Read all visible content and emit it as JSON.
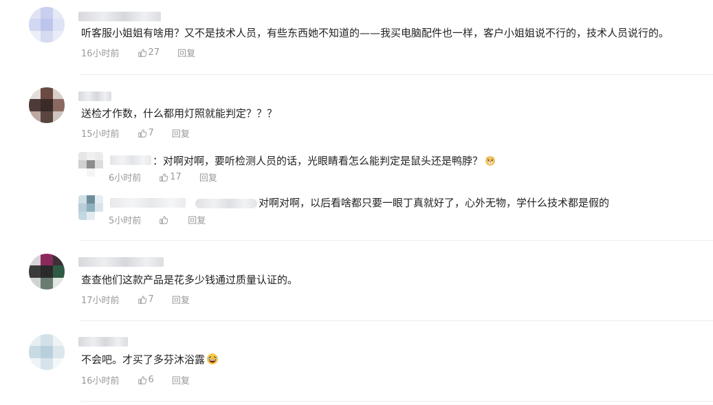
{
  "comments": [
    {
      "text": "听客服小姐姐有啥用？又不是技术人员，有些东西她不知道的——我买电脑配件也一样，客户小姐姐说不行的，技术人员说行的。",
      "time": "16小时前",
      "likes": "27",
      "reply": "回复"
    },
    {
      "text": "送检才作数，什么都用灯照就能判定？？？",
      "time": "15小时前",
      "likes": "7",
      "reply": "回复",
      "replies": [
        {
          "text": "：对啊对啊，要听检测人员的话，光眼睛看怎么能判定是鼠头还是鸭脖？",
          "emoji": "doge-emoji",
          "time": "6小时前",
          "likes": "17",
          "reply": "回复"
        },
        {
          "text": "对啊对啊，以后看啥都只要一眼丁真就好了，心外无物，学什么技术都是假的",
          "time": "5小时前",
          "likes": "",
          "reply": "回复"
        }
      ]
    },
    {
      "text": "查查他们这款产品是花多少钱通过质量认证的。",
      "time": "17小时前",
      "likes": "7",
      "reply": "回复"
    },
    {
      "text": "不会吧。才买了多芬沐浴露",
      "emoji": "laughing-emoji",
      "time": "16小时前",
      "likes": "6",
      "reply": "回复"
    }
  ],
  "colors": {
    "text": "#222222",
    "meta": "#999999",
    "divider": "#ececec"
  }
}
